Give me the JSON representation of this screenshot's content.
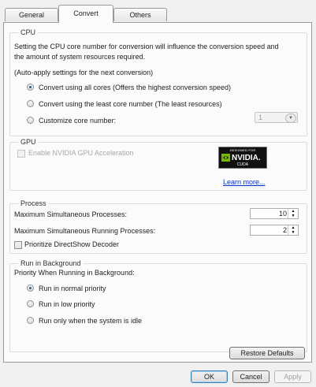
{
  "tabs": [
    {
      "label": "General"
    },
    {
      "label": "Convert"
    },
    {
      "label": "Others"
    }
  ],
  "cpu": {
    "title": "CPU",
    "description_line1": "Setting the CPU core number for conversion will influence the conversion speed and",
    "description_line2": "the amount of system resources required.",
    "auto_apply": "(Auto-apply settings for the next conversion)",
    "options": [
      {
        "label": "Convert using all cores (Offers the highest conversion speed)",
        "checked": true
      },
      {
        "label": "Convert using the least core number (The least resources)",
        "checked": false
      },
      {
        "label": "Customize core number:",
        "checked": false
      }
    ],
    "core_number": "1"
  },
  "gpu": {
    "title": "GPU",
    "enable_label": "Enable NVIDIA GPU Acceleration",
    "badge_designed": "DESIGNED FOR",
    "badge_brand": "NVIDIA.",
    "badge_product": "CUDA",
    "learn_more": "Learn more..."
  },
  "process": {
    "title": "Process",
    "max_simultaneous_label": "Maximum Simultaneous Processes:",
    "max_simultaneous_value": "10",
    "max_running_label": "Maximum Simultaneous Running Processes:",
    "max_running_value": "2",
    "prioritize_label": "Prioritize DirectShow Decoder"
  },
  "background": {
    "title": "Run in Background",
    "priority_label": "Priority When Running in Background:",
    "options": [
      {
        "label": "Run in normal priority",
        "checked": true
      },
      {
        "label": "Run in low priority",
        "checked": false
      },
      {
        "label": "Run only when the system is idle",
        "checked": false
      }
    ]
  },
  "buttons": {
    "restore": "Restore Defaults",
    "ok": "OK",
    "cancel": "Cancel",
    "apply": "Apply"
  },
  "colors": {
    "link": "#0033cc",
    "group_border": "#d5dfe5",
    "radio_dot": "#2e5a87"
  }
}
